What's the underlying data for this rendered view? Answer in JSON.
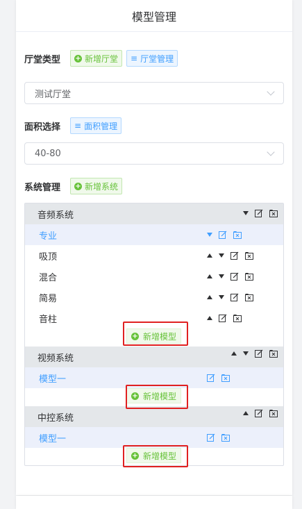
{
  "header": {
    "title": "模型管理"
  },
  "hall": {
    "label": "厅堂类型",
    "add_label": "新增厅堂",
    "manage_label": "厅堂管理",
    "select_value": "测试厅堂"
  },
  "area": {
    "label": "面积选择",
    "manage_label": "面积管理",
    "select_value": "40-80"
  },
  "system": {
    "label": "系统管理",
    "add_label": "新增系统"
  },
  "groups": [
    {
      "name": "音频系统",
      "items": [
        "专业",
        "吸顶",
        "混合",
        "简易",
        "音柱"
      ],
      "add_label": "新增模型"
    },
    {
      "name": "视频系统",
      "items": [
        "模型一"
      ],
      "add_label": "新增模型"
    },
    {
      "name": "中控系统",
      "items": [
        "模型一"
      ],
      "add_label": "新增模型"
    }
  ],
  "icons": {
    "plus": "plus-circle-icon",
    "manage": "menu-lines-icon",
    "up": "arrow-up-icon",
    "down": "arrow-down-icon",
    "edit": "edit-icon",
    "delete": "folder-delete-icon"
  },
  "colors": {
    "primary": "#409eff",
    "success": "#67c23a",
    "highlight": "#e02020"
  }
}
